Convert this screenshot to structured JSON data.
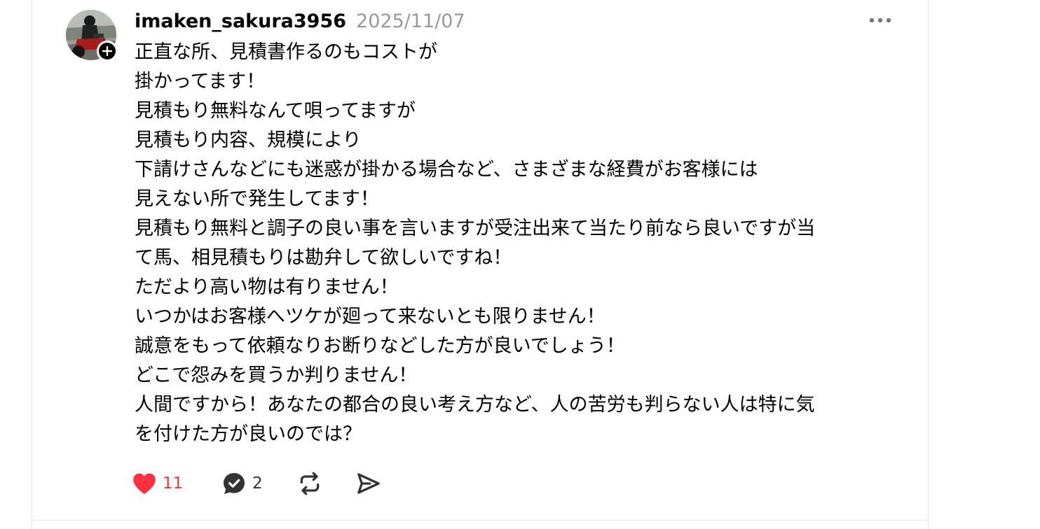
{
  "accent_color": "#ff3040",
  "muted_color": "#999999",
  "post": {
    "username": "imaken_sakura3956",
    "date": "2025/11/07",
    "avatar_icon": "avatar-photo",
    "follow_icon": "plus-icon",
    "more_icon": "more-dots-icon",
    "lines": [
      "正直な所、見積書作るのもコストが",
      "掛かってます！",
      "見積もり無料なんて唄ってますが",
      "見積もり内容、規模により",
      "下請けさんなどにも迷惑が掛かる場合など、さまざまな経費がお客様には",
      "見えない所で発生してます！",
      "見積もり無料と調子の良い事を言いますが受注出来て当たり前なら良いですが当",
      "て馬、相見積もりは勘弁して欲しいですね！",
      "ただより高い物は有りません！",
      "いつかはお客様へツケが廻って来ないとも限りません！",
      "誠意をもって依頼なりお断りなどした方が良いでしょう！",
      "どこで怨みを買うか判りません！",
      "人間ですから！あなたの都合の良い考え方など、人の苦労も判らない人は特に気",
      "を付けた方が良いのでは？"
    ],
    "actions": {
      "like": {
        "icon": "heart-icon",
        "count": "11",
        "liked": true
      },
      "comment": {
        "icon": "comment-icon",
        "count": "2"
      },
      "repost": {
        "icon": "repost-icon"
      },
      "share": {
        "icon": "send-icon"
      }
    }
  }
}
